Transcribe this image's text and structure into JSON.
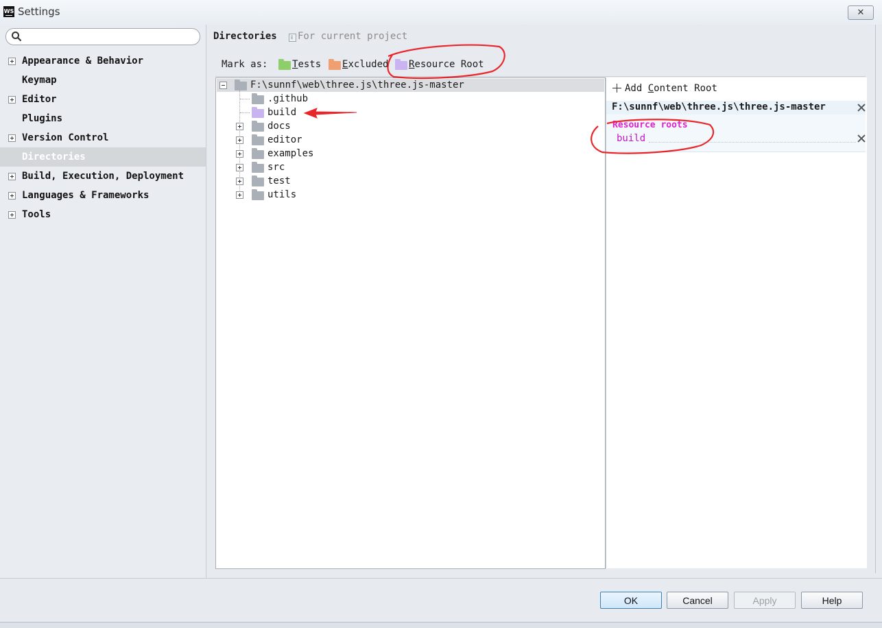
{
  "window": {
    "title": "Settings",
    "app_icon": "WS",
    "close_icon": "close-icon"
  },
  "search": {
    "value": "",
    "placeholder": ""
  },
  "sidebar": {
    "items": [
      {
        "label": "Appearance & Behavior",
        "expandable": true
      },
      {
        "label": "Keymap",
        "expandable": false
      },
      {
        "label": "Editor",
        "expandable": true
      },
      {
        "label": "Plugins",
        "expandable": false
      },
      {
        "label": "Version Control",
        "expandable": true
      },
      {
        "label": "Directories",
        "expandable": false,
        "selected": true
      },
      {
        "label": "Build, Execution, Deployment",
        "expandable": true
      },
      {
        "label": "Languages & Frameworks",
        "expandable": true
      },
      {
        "label": "Tools",
        "expandable": true
      }
    ]
  },
  "header": {
    "title": "Directories",
    "scope": "For current project"
  },
  "mark_as": {
    "label": "Mark as:",
    "buttons": [
      {
        "mnemonic": "T",
        "rest": "ests",
        "color": "#8fcf6b"
      },
      {
        "mnemonic": "E",
        "rest": "xcluded",
        "color": "#f0a070"
      },
      {
        "mnemonic": "R",
        "rest": "esource Root",
        "color": "#c9b3f0"
      }
    ]
  },
  "tree": {
    "root": "F:\\sunnf\\web\\three.js\\three.js-master",
    "children": [
      ".github",
      "build",
      "docs",
      "editor",
      "examples",
      "src",
      "test",
      "utils"
    ]
  },
  "content_roots": {
    "add_prefix": "Add ",
    "add_mnemonic": "C",
    "add_rest": "ontent Root",
    "path": "F:\\sunnf\\web\\three.js\\three.js-master",
    "section_heading": "Resource roots",
    "section_items": [
      "build"
    ]
  },
  "buttons": {
    "ok": "OK",
    "cancel": "Cancel",
    "apply": "Apply",
    "help": "Help"
  },
  "colors": {
    "folder_default": "#a9b0b8",
    "folder_resource": "#c9b3f0",
    "resource_heading": "#e01fd0",
    "annotation": "#e8262b"
  }
}
